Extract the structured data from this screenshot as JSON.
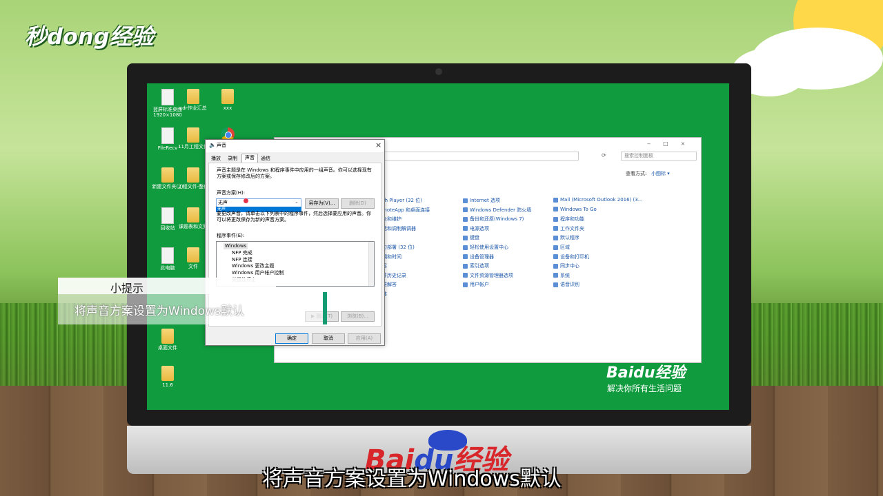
{
  "watermark": {
    "logo_text": "秒dong经验"
  },
  "desktop": {
    "icons": [
      {
        "label": "蓝屏标准桌面1920×1080",
        "type": "file"
      },
      {
        "label": "cdr作业汇总",
        "type": "folder"
      },
      {
        "label": "xxx",
        "type": "folder"
      },
      {
        "label": "FileRecv",
        "type": "file"
      },
      {
        "label": "11月工程文件",
        "type": "folder"
      },
      {
        "label": "",
        "type": "chrome"
      },
      {
        "label": "新建文件夹(2)",
        "type": "folder"
      },
      {
        "label": "工程文件-整件",
        "type": "folder"
      },
      {
        "label": "回收站",
        "type": "file"
      },
      {
        "label": "课题表和文案",
        "type": "folder"
      },
      {
        "label": "此电脑",
        "type": "file"
      },
      {
        "label": "文件",
        "type": "folder"
      },
      {
        "label": "桌面文件",
        "type": "folder"
      },
      {
        "label": "11.6",
        "type": "folder"
      }
    ]
  },
  "control_panel": {
    "search_placeholder": "搜索控制面板",
    "view_label": "查看方式:",
    "view_value": "小图标 ▾",
    "columns": [
      [
        "sh Player (32 位)",
        "moteApp 和桌面连接",
        "全和维护",
        "话和调制解调器",
        "",
        "力部署 (32 位)",
        "期和时间",
        "标",
        "件历史记录",
        "难解答",
        "体"
      ],
      [
        "Internet 选项",
        "Windows Defender 防火墙",
        "备份和还原(Windows 7)",
        "电源选项",
        "键盘",
        "轻松使用设置中心",
        "设备管理器",
        "索引选项",
        "文件资源管理器选项",
        "用户帐户"
      ],
      [
        "Mail (Microsoft Outlook 2016) (3...",
        "Windows To Go",
        "程序和功能",
        "工作文件夹",
        "默认程序",
        "区域",
        "设备和打印机",
        "同步中心",
        "系统",
        "语音识别"
      ]
    ]
  },
  "sound_dialog": {
    "title": "声音",
    "close": "×",
    "tabs": [
      "播放",
      "录制",
      "声音",
      "通信"
    ],
    "description": "声音主题是在 Windows 和程序事件中应用的一组声音。你可以选择现有方案或保存修改后的方案。",
    "scheme_label": "声音方案(H):",
    "scheme_value": "无声",
    "dropdown_option": "无声",
    "save_as": "另存为(V)...",
    "delete": "删除(D)",
    "change_text": "要更改声音，请单击以下列表中的程序事件，然后选择要应用的声音。你可以将更改保存为新的声音方案。",
    "events_label": "程序事件(E):",
    "events": [
      "Windows",
      "NFP 完成",
      "NFP 连接",
      "Windows 更改主题",
      "Windows 用户帐户控制",
      "关键性停止"
    ],
    "test_button": "▶ 测试(T)",
    "browse_button": "浏览(B)...",
    "ok": "确定",
    "cancel": "取消",
    "apply": "应用(A)"
  },
  "hint": {
    "title": "小提示",
    "text": "将声音方案设置为Windows默认"
  },
  "baidu_screen": {
    "logo": "Bai",
    "logo_du": "du",
    "logo_suffix": "经验",
    "slogan": "解决你所有生活问题"
  },
  "baidu_chin": {
    "logo": "Bai",
    "logo_du": "du",
    "logo_suffix": "经验"
  },
  "subtitle": "将声音方案设置为Windows默认"
}
